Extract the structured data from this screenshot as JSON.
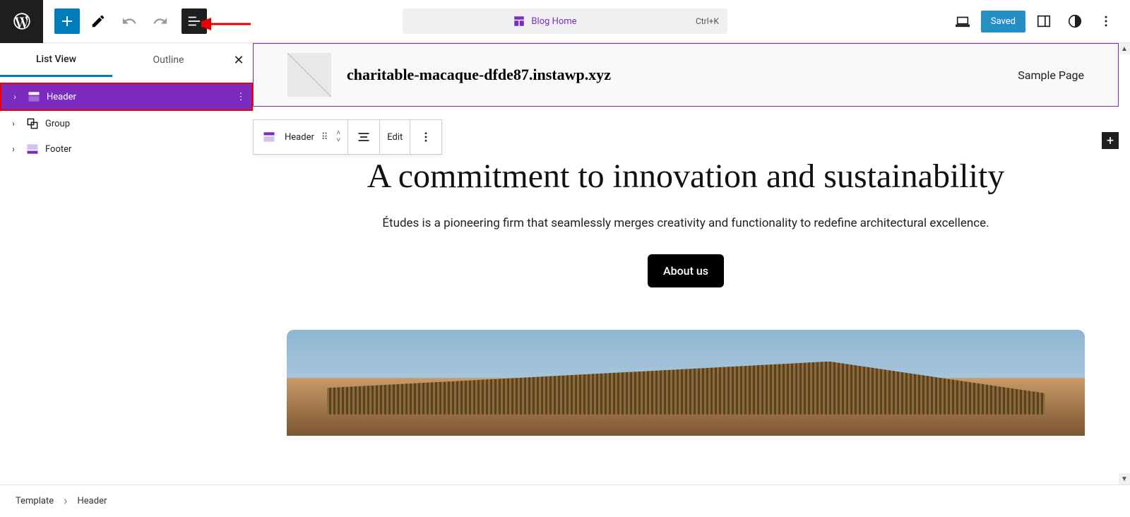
{
  "toolbar": {
    "center_label": "Blog Home",
    "shortcut": "Ctrl+K",
    "saved_label": "Saved"
  },
  "sidebar": {
    "tabs": {
      "list_view": "List View",
      "outline": "Outline"
    },
    "items": [
      {
        "label": "Header"
      },
      {
        "label": "Group"
      },
      {
        "label": "Footer"
      }
    ]
  },
  "block_toolbar": {
    "name": "Header",
    "edit": "Edit"
  },
  "header_block": {
    "site_title": "charitable-macaque-dfde87.instawp.xyz",
    "nav_item": "Sample Page"
  },
  "content": {
    "heading": "A commitment to innovation and sustainability",
    "paragraph": "Études is a pioneering firm that seamlessly merges creativity and functionality to redefine architectural excellence.",
    "button": "About us"
  },
  "breadcrumb": {
    "root": "Template",
    "current": "Header"
  }
}
